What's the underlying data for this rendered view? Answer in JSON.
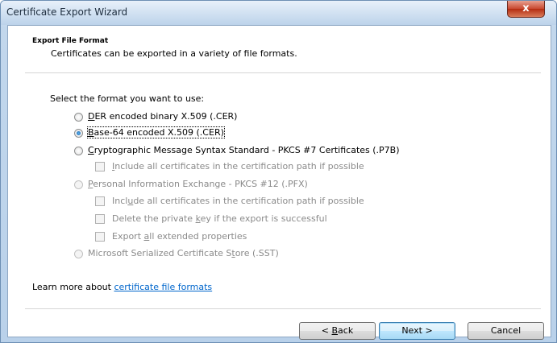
{
  "window": {
    "title": "Certificate Export Wizard",
    "close_glyph": "x"
  },
  "header": {
    "title": "Export File Format",
    "subtitle": "Certificates can be exported in a variety of file formats."
  },
  "prompt": "Select the format you want to use:",
  "options": {
    "der": {
      "pre": "",
      "key": "D",
      "post": "ER encoded binary X.509 (.CER)",
      "selected": false,
      "enabled": true
    },
    "base64": {
      "pre": "",
      "key": "B",
      "post": "ase-64 encoded X.509 (.CER)",
      "selected": true,
      "enabled": true
    },
    "pkcs7": {
      "pre": "",
      "key": "C",
      "post": "ryptographic Message Syntax Standard - PKCS #7 Certificates (.P7B)",
      "selected": false,
      "enabled": true
    },
    "pkcs7_include": {
      "pre": "",
      "key": "I",
      "post": "nclude all certificates in the certification path if possible",
      "checked": false,
      "enabled": false
    },
    "pfx": {
      "pre": "",
      "key": "P",
      "post": "ersonal Information Exchange - PKCS #12 (.PFX)",
      "selected": false,
      "enabled": false
    },
    "pfx_include": {
      "pre": "Incl",
      "key": "u",
      "post": "de all certificates in the certification path if possible",
      "checked": false,
      "enabled": false
    },
    "pfx_delete": {
      "pre": "Delete the private ",
      "key": "k",
      "post": "ey if the export is successful",
      "checked": false,
      "enabled": false
    },
    "pfx_export": {
      "pre": "Export ",
      "key": "a",
      "post": "ll extended properties",
      "checked": false,
      "enabled": false
    },
    "sst": {
      "pre": "Microsoft Serialized Certificate S",
      "key": "t",
      "post": "ore (.SST)",
      "selected": false,
      "enabled": false
    }
  },
  "learn_more": {
    "prefix": "Learn more about ",
    "link": "certificate file formats"
  },
  "buttons": {
    "back": {
      "pre": "< ",
      "key": "B",
      "post": "ack"
    },
    "next": "Next >",
    "cancel": "Cancel"
  }
}
